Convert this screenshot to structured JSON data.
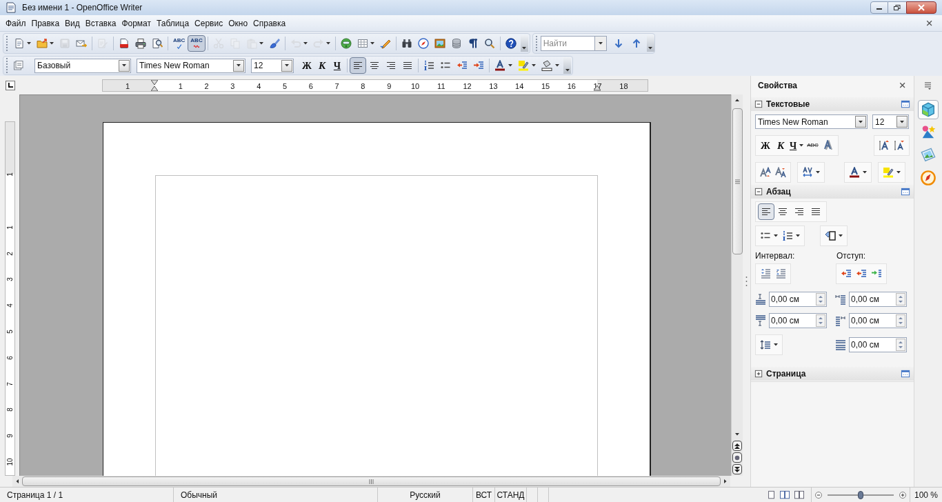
{
  "window": {
    "title": "Без имени 1 - OpenOffice Writer"
  },
  "menu": [
    "Файл",
    "Правка",
    "Вид",
    "Вставка",
    "Формат",
    "Таблица",
    "Сервис",
    "Окно",
    "Справка"
  ],
  "standard_toolbar": [
    {
      "disabled": false,
      "on": false
    },
    {
      "disabled": false,
      "on": false
    },
    {
      "disabled": true,
      "on": false
    },
    {
      "disabled": false,
      "on": false
    },
    {
      "disabled": true,
      "on": false
    },
    {
      "disabled": false,
      "on": false
    },
    {
      "disabled": false,
      "on": false
    },
    {
      "disabled": false,
      "on": false
    },
    {
      "disabled": false,
      "label": "ABC"
    },
    {
      "disabled": false,
      "on": true,
      "label": "ABC"
    },
    {
      "disabled": true,
      "on": false
    },
    {
      "disabled": true,
      "on": false
    },
    {
      "disabled": true,
      "on": false
    },
    {
      "disabled": false,
      "on": false
    },
    {
      "disabled": true,
      "on": false
    },
    {
      "disabled": true,
      "on": false
    },
    {
      "disabled": false,
      "on": false
    },
    {
      "disabled": false,
      "on": false
    },
    {
      "disabled": false,
      "on": false
    },
    {
      "disabled": false,
      "on": false
    },
    {
      "disabled": false,
      "on": false
    },
    {
      "disabled": false,
      "on": false
    },
    {
      "disabled": false,
      "on": false
    },
    {
      "disabled": false,
      "on": false
    },
    {
      "disabled": false,
      "on": false
    },
    {
      "disabled": false,
      "on": false
    }
  ],
  "find_toolbar": {
    "placeholder": "Найти"
  },
  "formatting_toolbar": {
    "style": "Базовый",
    "font": "Times New Roman",
    "size": "12",
    "bold": "Ж",
    "italic": "К",
    "underline": "Ч",
    "align": [
      {
        "selected": true
      },
      {
        "selected": false
      },
      {
        "selected": false
      },
      {
        "selected": false
      }
    ]
  },
  "ruler": {
    "horizontal": [
      "1",
      "1",
      "2",
      "3",
      "4",
      "5",
      "6",
      "7",
      "8",
      "9",
      "10",
      "11",
      "12",
      "13",
      "14",
      "15",
      "16",
      "17",
      "18"
    ],
    "vertical": [
      "1",
      "1",
      "2",
      "3",
      "4",
      "5",
      "6",
      "7",
      "8",
      "9",
      "10"
    ]
  },
  "sidebar": {
    "title": "Свойства",
    "sections": [
      {
        "title": "Текстовые",
        "expanded": true
      },
      {
        "title": "Абзац",
        "expanded": true
      },
      {
        "title": "Страница",
        "expanded": false
      }
    ],
    "character": {
      "font": "Times New Roman",
      "size": "12",
      "bold": "Ж",
      "italic": "К",
      "underline": "Ч",
      "strikethrough": "ABC"
    },
    "paragraph": {
      "align": [
        {
          "selected": true
        },
        {
          "selected": false
        },
        {
          "selected": false
        },
        {
          "selected": false
        }
      ],
      "spacing_label": "Интервал:",
      "indent_label": "Отступ:",
      "fields": [
        "0,00 см",
        "0,00 см",
        "0,00 см",
        "0,00 см",
        "0,00 см"
      ]
    },
    "tabs": [
      {
        "selected": true
      },
      {
        "selected": false
      },
      {
        "selected": false
      },
      {
        "selected": false
      }
    ]
  },
  "status_bar": {
    "page": "Страница 1 / 1",
    "style": "Обычный",
    "language": "Русский",
    "insert_mode": "ВСТ",
    "selection_mode": "СТАНД",
    "zoom_slider": {
      "level": 0.5
    },
    "zoom": "100 %"
  }
}
